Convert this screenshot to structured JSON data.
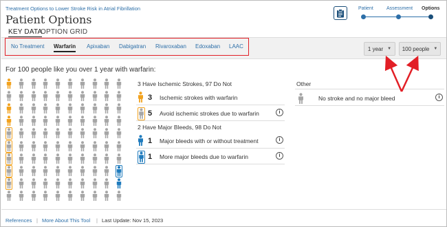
{
  "header": {
    "breadcrumb": "Treatment Options to Lower Stroke Risk in Atrial Fibrillation",
    "title": "Patient Options",
    "clipboard_icon": "clipboard-icon"
  },
  "stepper": {
    "steps": [
      "Patient",
      "Assessment",
      "Options"
    ],
    "current": "Options"
  },
  "tabs": [
    "KEY DATA",
    "OPTION GRID"
  ],
  "active_tab": "KEY DATA",
  "drugs": [
    "No Treatment",
    "Warfarin",
    "Apixaban",
    "Dabigatran",
    "Rivaroxaban",
    "Edoxaban",
    "LAAC"
  ],
  "active_drug": "Warfarin",
  "time_select": {
    "value": "1 year"
  },
  "people_select": {
    "value": "100 people"
  },
  "summary": "For 100 people like you over 1 year with warfarin:",
  "sections": {
    "strokes_title": "3 Have Ischemic Strokes, 97 Do Not",
    "strokes_rows": [
      {
        "num": "3",
        "text": "Ischemic strokes with warfarin"
      },
      {
        "num": "5",
        "text": "Avoid ischemic strokes due to warfarin"
      }
    ],
    "bleeds_title": "2 Have Major Bleeds, 98 Do Not",
    "bleeds_rows": [
      {
        "num": "1",
        "text": "Major bleeds with or without treatment"
      },
      {
        "num": "1",
        "text": "More major bleeds due to warfarin"
      }
    ],
    "other_title": "Other",
    "other_row": "No stroke and no major bleed"
  },
  "footer": {
    "references": "References",
    "separator": "|",
    "more_about": "More About This Tool",
    "last_update": "Last Update: Nov 15, 2023"
  },
  "colors": {
    "orange": "#f2a21e",
    "blue": "#1f7bbd",
    "grey": "#a6a6a6",
    "red_annotation": "#e21f26",
    "link": "#2d6fa8"
  },
  "icon_grid": {
    "columns": 10,
    "rows": 10,
    "stroke_count": 3,
    "avoided_stroke_count": 5,
    "bleed_base_count": 1,
    "bleed_extra_count": 1
  }
}
